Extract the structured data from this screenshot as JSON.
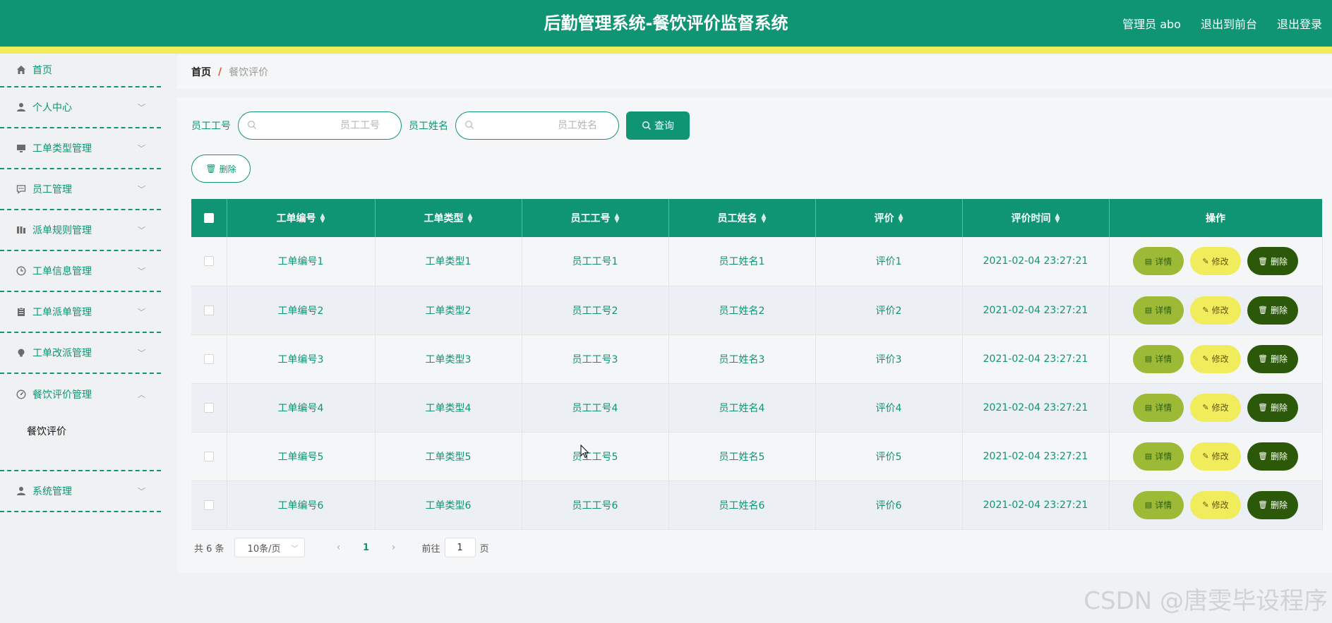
{
  "header": {
    "title": "后勤管理系统-餐饮评价监督系统",
    "user": "管理员 abo",
    "to_front": "退出到前台",
    "logout": "退出登录"
  },
  "sidebar": {
    "items": [
      {
        "label": "首页",
        "icon": "home-icon"
      },
      {
        "label": "个人中心",
        "icon": "user-icon"
      },
      {
        "label": "工单类型管理",
        "icon": "monitor-icon"
      },
      {
        "label": "员工管理",
        "icon": "chat-icon"
      },
      {
        "label": "派单规则管理",
        "icon": "bars-icon"
      },
      {
        "label": "工单信息管理",
        "icon": "clock-icon"
      },
      {
        "label": "工单派单管理",
        "icon": "clipboard-icon"
      },
      {
        "label": "工单改派管理",
        "icon": "bulb-icon"
      },
      {
        "label": "餐饮评价管理",
        "icon": "gauge-icon"
      },
      {
        "label": "系统管理",
        "icon": "user-icon"
      }
    ],
    "sub_item": "餐饮评价"
  },
  "breadcrumb": {
    "home": "首页",
    "separator": "/",
    "current": "餐饮评价"
  },
  "search": {
    "label_id": "员工工号",
    "placeholder_id": "员工工号",
    "label_name": "员工姓名",
    "placeholder_name": "员工姓名",
    "query_label": "查询"
  },
  "actions": {
    "delete_label": "删除"
  },
  "table": {
    "columns": [
      "工单编号",
      "工单类型",
      "员工工号",
      "员工姓名",
      "评价",
      "评价时间",
      "操作"
    ],
    "rows": [
      [
        "工单编号1",
        "工单类型1",
        "员工工号1",
        "员工姓名1",
        "评价1",
        "2021-02-04 23:27:21"
      ],
      [
        "工单编号2",
        "工单类型2",
        "员工工号2",
        "员工姓名2",
        "评价2",
        "2021-02-04 23:27:21"
      ],
      [
        "工单编号3",
        "工单类型3",
        "员工工号3",
        "员工姓名3",
        "评价3",
        "2021-02-04 23:27:21"
      ],
      [
        "工单编号4",
        "工单类型4",
        "员工工号4",
        "员工姓名4",
        "评价4",
        "2021-02-04 23:27:21"
      ],
      [
        "工单编号5",
        "工单类型5",
        "员工工号5",
        "员工姓名5",
        "评价5",
        "2021-02-04 23:27:21"
      ],
      [
        "工单编号6",
        "工单类型6",
        "员工工号6",
        "员工姓名6",
        "评价6",
        "2021-02-04 23:27:21"
      ]
    ],
    "op_detail": "详情",
    "op_edit": "修改",
    "op_delete": "删除"
  },
  "pager": {
    "total": "共 6 条",
    "page_size": "10条/页",
    "current_page": "1",
    "goto_label": "前往",
    "goto_value": "1",
    "page_unit": "页"
  },
  "watermark": "CSDN @唐雯毕设程序",
  "colors": {
    "primary": "#0f9474",
    "accent_yellow": "#f1ec5c",
    "detail_button": "#9cba35",
    "delete_button": "#2c5909"
  }
}
